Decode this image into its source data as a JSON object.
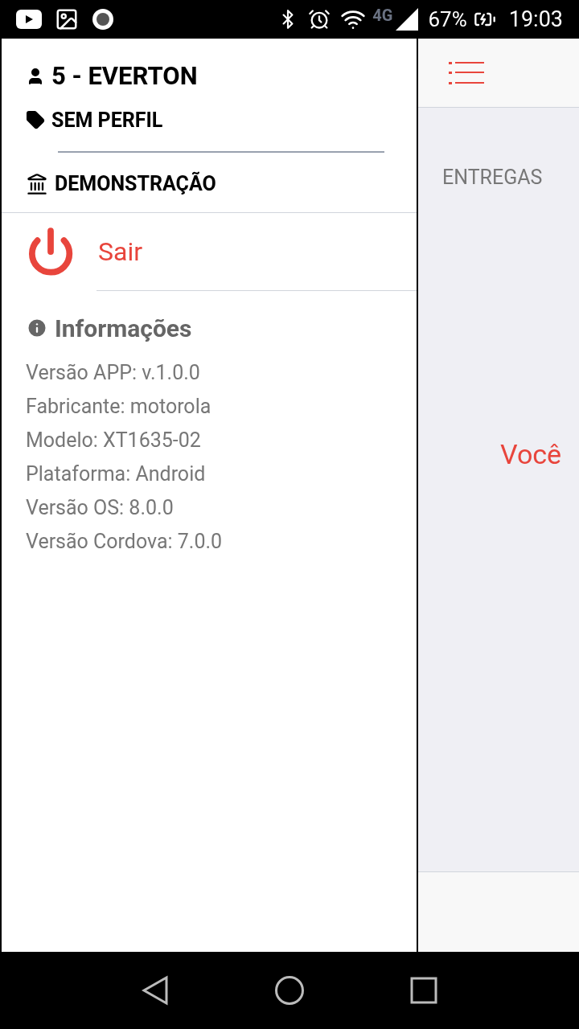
{
  "status_bar": {
    "network": "4G",
    "battery": "67%",
    "time": "19:03"
  },
  "drawer": {
    "user": "5 - EVERTON",
    "profile": "SEM PERFIL",
    "company": "DEMONSTRAÇÃO",
    "logout": "Sair",
    "info_title": "Informações",
    "info_lines": [
      "Versão APP: v.1.0.0",
      "Fabricante: motorola",
      "Modelo: XT1635-02",
      "Plataforma: Android",
      "Versão OS: 8.0.0",
      "Versão Cordova: 7.0.0"
    ]
  },
  "main": {
    "section": "ENTREGAS",
    "message": "Você"
  }
}
